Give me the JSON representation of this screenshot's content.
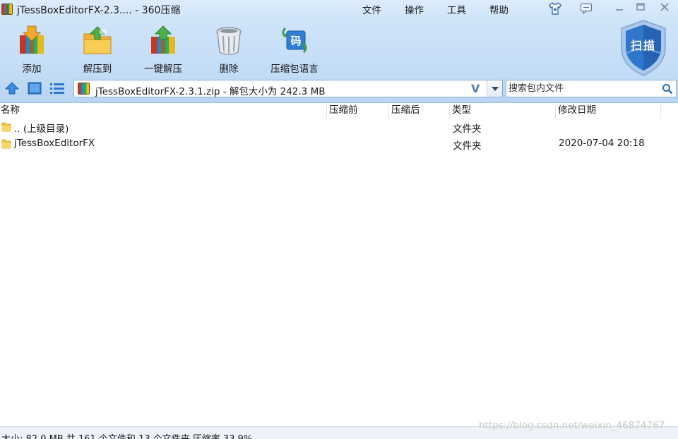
{
  "window": {
    "title": "jTessBoxEditorFX-2.3.... - 360压缩"
  },
  "menu": [
    {
      "label": "文件",
      "name": "menu-file"
    },
    {
      "label": "操作",
      "name": "menu-operate"
    },
    {
      "label": "工具",
      "name": "menu-tools"
    },
    {
      "label": "帮助",
      "name": "menu-help"
    }
  ],
  "toolbar": {
    "add": "添加",
    "extract_to": "解压到",
    "one_click_extract": "一键解压",
    "delete": "删除",
    "archive_language": "压缩包语言"
  },
  "scan_label": "扫描",
  "address": {
    "path": "jTessBoxEditorFX-2.3.1.zip - 解包大小为 242.3 MB"
  },
  "search": {
    "placeholder": "搜索包内文件"
  },
  "columns": {
    "name": "名称",
    "packed": "压缩前",
    "compressed": "压缩后",
    "type": "类型",
    "modified": "修改日期"
  },
  "rows": [
    {
      "name": ".. (上级目录)",
      "packed": "",
      "compressed": "",
      "type": "文件夹",
      "modified": ""
    },
    {
      "name": "jTessBoxEditorFX",
      "packed": "",
      "compressed": "",
      "type": "文件夹",
      "modified": "2020-07-04 20:18"
    }
  ],
  "status": "大小: 82.0 MB 共 161 个文件和 13 个文件夹 压缩率 33.9%",
  "watermark": "https://blog.csdn.net/weixin_46874767",
  "colors": {
    "chrome_top": "#dcecfb",
    "chrome_bottom": "#b9d5f3",
    "folder": "#f5c342",
    "accent": "#2b78d1"
  },
  "icons": {
    "skin": "tshirt-icon",
    "message": "message-icon",
    "nav_up": "up-arrow-icon",
    "view_icons": "thumbnail-view-icon",
    "view_list": "list-view-icon",
    "search": "search-icon"
  }
}
